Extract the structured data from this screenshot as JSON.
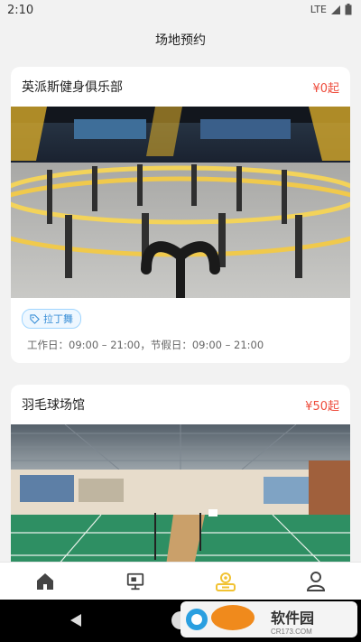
{
  "status": {
    "time": "2:10",
    "network": "LTE"
  },
  "header": {
    "title": "场地预约"
  },
  "venues": [
    {
      "name": "英派斯健身俱乐部",
      "price": "¥0起",
      "tag": "拉丁舞",
      "hours": "工作日：09:00 – 21:00，节假日：09:00 – 21:00"
    },
    {
      "name": "羽毛球场馆",
      "price": "¥50起"
    }
  ],
  "tabbar": {
    "items": [
      "home-icon",
      "venue-board-icon",
      "booking-icon",
      "user-icon"
    ],
    "active": 2,
    "active_color": "#f1c232",
    "inactive_color": "#444444"
  },
  "watermark": {
    "text": "软件园",
    "subtext": "CR173.COM"
  }
}
